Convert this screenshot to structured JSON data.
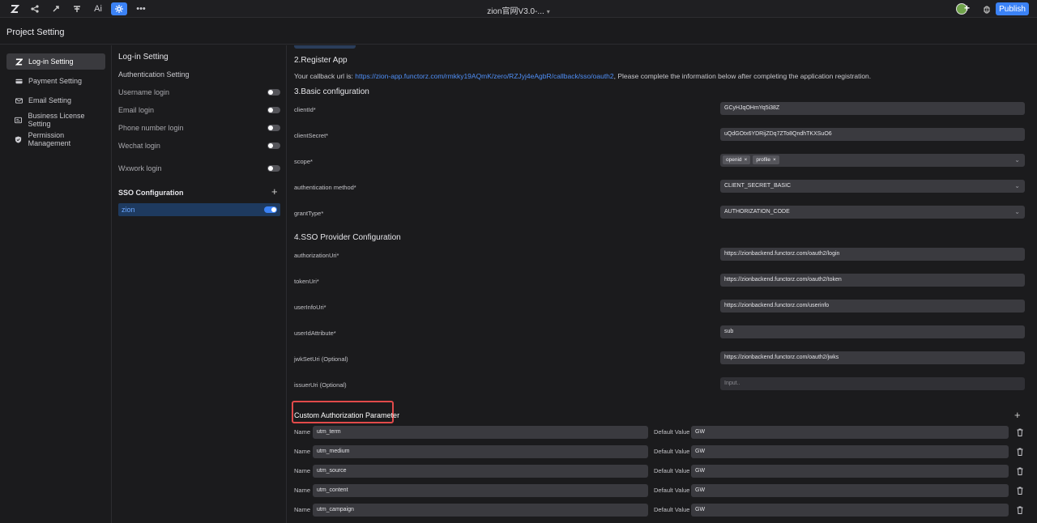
{
  "topbar": {
    "icons": [
      "logo-icon",
      "share-icon",
      "rocket-icon",
      "layout-icon",
      "ai-icon",
      "settings-icon",
      "more-icon"
    ],
    "ai_label": "Ai",
    "more_label": "•••",
    "title": "zion官网V3.0-...",
    "title_caret": "▾",
    "publish_label": "Publish",
    "accent": "#3b82f6"
  },
  "project_header": {
    "title": "Project Setting"
  },
  "leftnav": {
    "items": [
      {
        "label": "Log-in Setting",
        "icon": "z-logo-icon",
        "active": true
      },
      {
        "label": "Payment Setting",
        "icon": "card-icon"
      },
      {
        "label": "Email Setting",
        "icon": "mail-icon"
      },
      {
        "label": "Business License Setting",
        "icon": "license-icon"
      },
      {
        "label": "Permission Management",
        "icon": "shield-icon"
      }
    ]
  },
  "midpanel": {
    "title": "Log-in Setting",
    "subtitle": "Authentication Setting",
    "toggles": [
      {
        "label": "Username login",
        "on": false
      },
      {
        "label": "Email login",
        "on": false
      },
      {
        "label": "Phone number login",
        "on": false
      },
      {
        "label": "Wechat login",
        "on": false
      },
      {
        "label": "Wxwork login",
        "on": false
      }
    ],
    "sso_title": "SSO Configuration",
    "sso_plus": "+",
    "sso_item": {
      "label": "zion",
      "on": true
    }
  },
  "main": {
    "register_title": "2.Register App",
    "callback_prefix": "Your callback url is: ",
    "callback_url": "https://zion-app.functorz.com/rmkky19AQmK/zero/RZJyj4eAgbR/callback/sso/oauth2",
    "callback_suffix": ", Please complete the information below after completing the application registration.",
    "basic_title": "3.Basic configuration",
    "basic_fields": {
      "clientId": {
        "label": "clientId*",
        "value": "GCyHJqOHmYq5i38Z"
      },
      "clientSecret": {
        "label": "clientSecret*",
        "value": "uQdGOtx6YDRijZDq7ZTo8QndhTKXSuO6"
      },
      "scope": {
        "label": "scope*",
        "chips": [
          "openid",
          "profile"
        ],
        "chip_x": "×"
      },
      "auth_method": {
        "label": "authentication method*",
        "value": "CLIENT_SECRET_BASIC"
      },
      "grantType": {
        "label": "grantType*",
        "value": "AUTHORIZATION_CODE"
      }
    },
    "chevron": "⌄",
    "provider_title": "4.SSO Provider Configuration",
    "provider_fields": {
      "authorizationUri": {
        "label": "authorizationUri*",
        "value": "https://zionbackend.functorz.com/oauth2/login"
      },
      "tokenUri": {
        "label": "tokenUri*",
        "value": "https://zionbackend.functorz.com/oauth2/token"
      },
      "userInfoUri": {
        "label": "userInfoUri*",
        "value": "https://zionbackend.functorz.com/userinfo"
      },
      "userIdAttribute": {
        "label": "userIdAttribute*",
        "value": "sub"
      },
      "jwkSetUri": {
        "label": "jwkSetUri (Optional)",
        "value": "https://zionbackend.functorz.com/oauth2/jwks"
      },
      "issuerUri": {
        "label": "issuerUri (Optional)",
        "placeholder": "Input.."
      }
    },
    "custom_title": "Custom Authorization Parameter",
    "custom_plus": "+",
    "param_name_label": "Name",
    "param_default_label": "Default Value",
    "params": [
      {
        "name": "utm_term",
        "default": "GW"
      },
      {
        "name": "utm_medium",
        "default": "GW"
      },
      {
        "name": "utm_source",
        "default": "GW"
      },
      {
        "name": "utm_content",
        "default": "GW"
      },
      {
        "name": "utm_campaign",
        "default": "GW"
      }
    ]
  }
}
